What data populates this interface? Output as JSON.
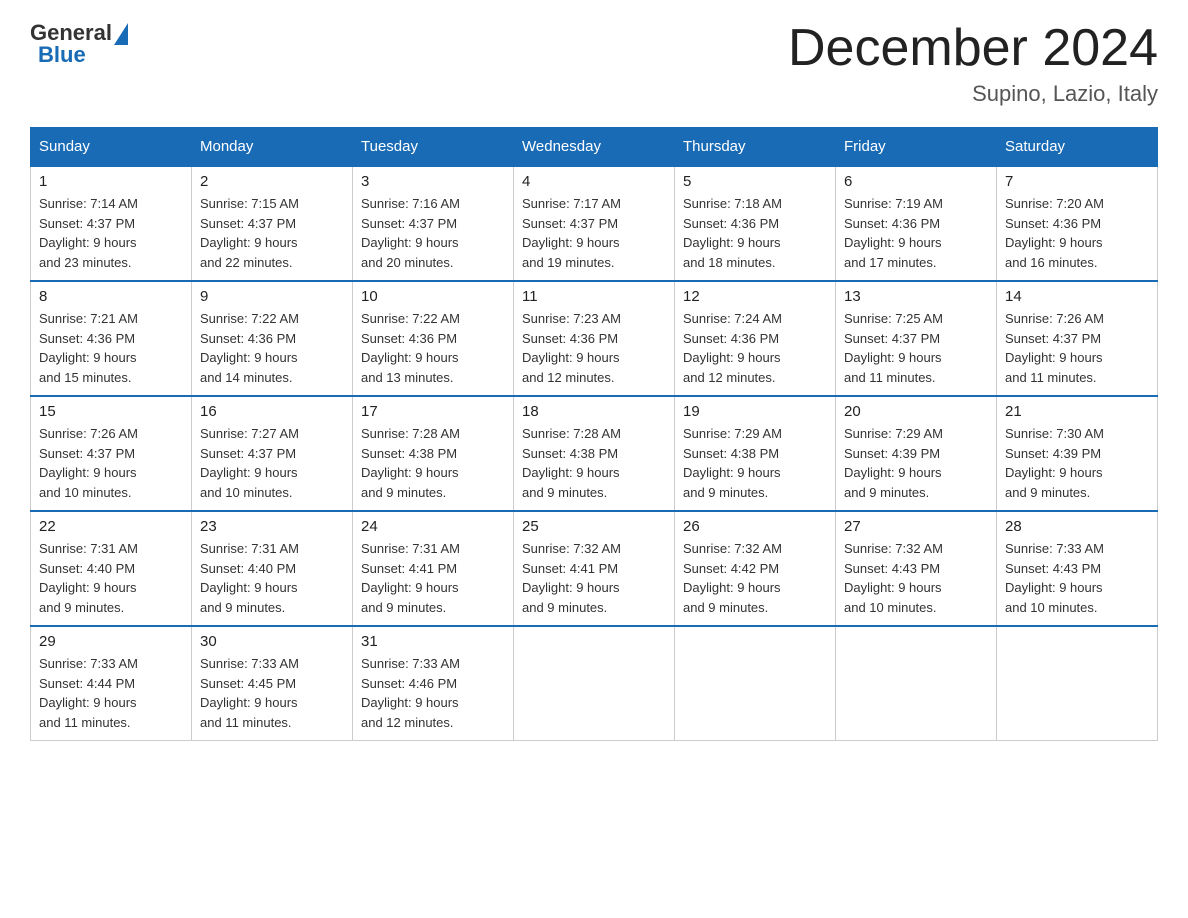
{
  "header": {
    "logo_general": "General",
    "logo_blue": "Blue",
    "month_title": "December 2024",
    "location": "Supino, Lazio, Italy"
  },
  "weekdays": [
    "Sunday",
    "Monday",
    "Tuesday",
    "Wednesday",
    "Thursday",
    "Friday",
    "Saturday"
  ],
  "weeks": [
    [
      {
        "day": "1",
        "sunrise": "7:14 AM",
        "sunset": "4:37 PM",
        "daylight": "9 hours and 23 minutes."
      },
      {
        "day": "2",
        "sunrise": "7:15 AM",
        "sunset": "4:37 PM",
        "daylight": "9 hours and 22 minutes."
      },
      {
        "day": "3",
        "sunrise": "7:16 AM",
        "sunset": "4:37 PM",
        "daylight": "9 hours and 20 minutes."
      },
      {
        "day": "4",
        "sunrise": "7:17 AM",
        "sunset": "4:37 PM",
        "daylight": "9 hours and 19 minutes."
      },
      {
        "day": "5",
        "sunrise": "7:18 AM",
        "sunset": "4:36 PM",
        "daylight": "9 hours and 18 minutes."
      },
      {
        "day": "6",
        "sunrise": "7:19 AM",
        "sunset": "4:36 PM",
        "daylight": "9 hours and 17 minutes."
      },
      {
        "day": "7",
        "sunrise": "7:20 AM",
        "sunset": "4:36 PM",
        "daylight": "9 hours and 16 minutes."
      }
    ],
    [
      {
        "day": "8",
        "sunrise": "7:21 AM",
        "sunset": "4:36 PM",
        "daylight": "9 hours and 15 minutes."
      },
      {
        "day": "9",
        "sunrise": "7:22 AM",
        "sunset": "4:36 PM",
        "daylight": "9 hours and 14 minutes."
      },
      {
        "day": "10",
        "sunrise": "7:22 AM",
        "sunset": "4:36 PM",
        "daylight": "9 hours and 13 minutes."
      },
      {
        "day": "11",
        "sunrise": "7:23 AM",
        "sunset": "4:36 PM",
        "daylight": "9 hours and 12 minutes."
      },
      {
        "day": "12",
        "sunrise": "7:24 AM",
        "sunset": "4:36 PM",
        "daylight": "9 hours and 12 minutes."
      },
      {
        "day": "13",
        "sunrise": "7:25 AM",
        "sunset": "4:37 PM",
        "daylight": "9 hours and 11 minutes."
      },
      {
        "day": "14",
        "sunrise": "7:26 AM",
        "sunset": "4:37 PM",
        "daylight": "9 hours and 11 minutes."
      }
    ],
    [
      {
        "day": "15",
        "sunrise": "7:26 AM",
        "sunset": "4:37 PM",
        "daylight": "9 hours and 10 minutes."
      },
      {
        "day": "16",
        "sunrise": "7:27 AM",
        "sunset": "4:37 PM",
        "daylight": "9 hours and 10 minutes."
      },
      {
        "day": "17",
        "sunrise": "7:28 AM",
        "sunset": "4:38 PM",
        "daylight": "9 hours and 9 minutes."
      },
      {
        "day": "18",
        "sunrise": "7:28 AM",
        "sunset": "4:38 PM",
        "daylight": "9 hours and 9 minutes."
      },
      {
        "day": "19",
        "sunrise": "7:29 AM",
        "sunset": "4:38 PM",
        "daylight": "9 hours and 9 minutes."
      },
      {
        "day": "20",
        "sunrise": "7:29 AM",
        "sunset": "4:39 PM",
        "daylight": "9 hours and 9 minutes."
      },
      {
        "day": "21",
        "sunrise": "7:30 AM",
        "sunset": "4:39 PM",
        "daylight": "9 hours and 9 minutes."
      }
    ],
    [
      {
        "day": "22",
        "sunrise": "7:31 AM",
        "sunset": "4:40 PM",
        "daylight": "9 hours and 9 minutes."
      },
      {
        "day": "23",
        "sunrise": "7:31 AM",
        "sunset": "4:40 PM",
        "daylight": "9 hours and 9 minutes."
      },
      {
        "day": "24",
        "sunrise": "7:31 AM",
        "sunset": "4:41 PM",
        "daylight": "9 hours and 9 minutes."
      },
      {
        "day": "25",
        "sunrise": "7:32 AM",
        "sunset": "4:41 PM",
        "daylight": "9 hours and 9 minutes."
      },
      {
        "day": "26",
        "sunrise": "7:32 AM",
        "sunset": "4:42 PM",
        "daylight": "9 hours and 9 minutes."
      },
      {
        "day": "27",
        "sunrise": "7:32 AM",
        "sunset": "4:43 PM",
        "daylight": "9 hours and 10 minutes."
      },
      {
        "day": "28",
        "sunrise": "7:33 AM",
        "sunset": "4:43 PM",
        "daylight": "9 hours and 10 minutes."
      }
    ],
    [
      {
        "day": "29",
        "sunrise": "7:33 AM",
        "sunset": "4:44 PM",
        "daylight": "9 hours and 11 minutes."
      },
      {
        "day": "30",
        "sunrise": "7:33 AM",
        "sunset": "4:45 PM",
        "daylight": "9 hours and 11 minutes."
      },
      {
        "day": "31",
        "sunrise": "7:33 AM",
        "sunset": "4:46 PM",
        "daylight": "9 hours and 12 minutes."
      },
      null,
      null,
      null,
      null
    ]
  ],
  "labels": {
    "sunrise": "Sunrise:",
    "sunset": "Sunset:",
    "daylight": "Daylight:"
  }
}
